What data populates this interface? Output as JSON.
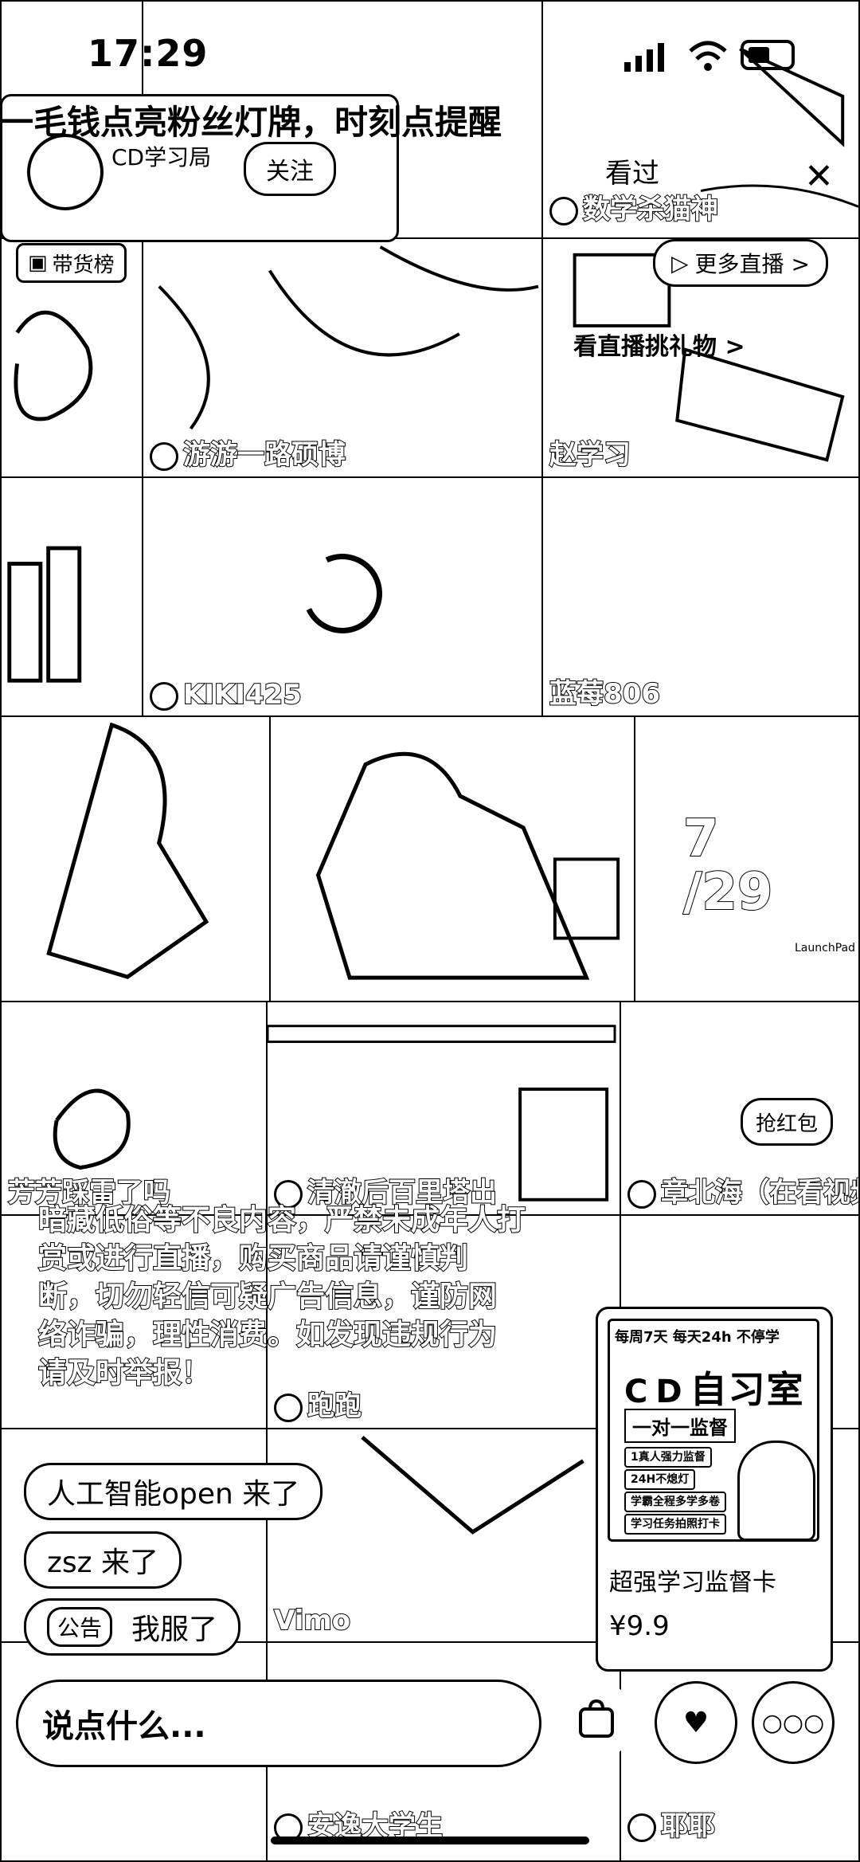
{
  "status_bar": {
    "time": "17:29"
  },
  "host": {
    "banner": "一毛钱点亮粉丝灯牌，时刻点提醒",
    "name": "CD学习局",
    "follow_label": "关注",
    "viewed_text": "看过",
    "close_icon": "close-icon"
  },
  "header": {
    "rank_label": "带货榜",
    "more_live_label": "更多直播 >",
    "gift_link": "看直播挑礼物 >"
  },
  "tiles": [
    {
      "name": "数学杀猫神"
    },
    {
      "name": "游游一路硕博"
    },
    {
      "name": "赵学习"
    },
    {
      "name": "KIKI425"
    },
    {
      "name": "蓝莓806"
    },
    {
      "name": "芳芳踩雷了吗"
    },
    {
      "name": "清澈后百里塔出"
    },
    {
      "name": "章北海（在看视频"
    },
    {
      "name": "跑跑"
    },
    {
      "name": "Vimo"
    },
    {
      "name": "安逸大学生"
    },
    {
      "name": "耶耶"
    }
  ],
  "date_badge": {
    "month": "7",
    "day": "/29",
    "brand": "LaunchPad"
  },
  "red_packet_label": "抢红包",
  "notice_lines": [
    "暗藏低俗等不良内容，严禁未成年人打",
    "赏或进行直播，购买商品请谨慎判",
    "断，切勿轻信可疑广告信息，谨防网",
    "络诈骗，理性消费。如发现违规行为",
    "请及时举报！"
  ],
  "product": {
    "top_line": "每周7天 每天24h 不停学",
    "brand": "CD",
    "brand_bold": "自习室",
    "subtitle": "一对一监督",
    "tags": [
      "1真人强力监督",
      "24H不熄灯",
      "学霸全程多学多卷",
      "学习任务拍照打卡"
    ],
    "title": "超强学习监督卡",
    "price": "¥9.9"
  },
  "chat_messages": [
    {
      "text": "人工智能open 来了"
    },
    {
      "text": "zsz 来了"
    }
  ],
  "announcement": {
    "tag": "公告",
    "text": "我服了"
  },
  "input": {
    "placeholder": "说点什么..."
  },
  "bottom_icons": [
    "cart-icon",
    "gift-icon",
    "more-icon"
  ]
}
